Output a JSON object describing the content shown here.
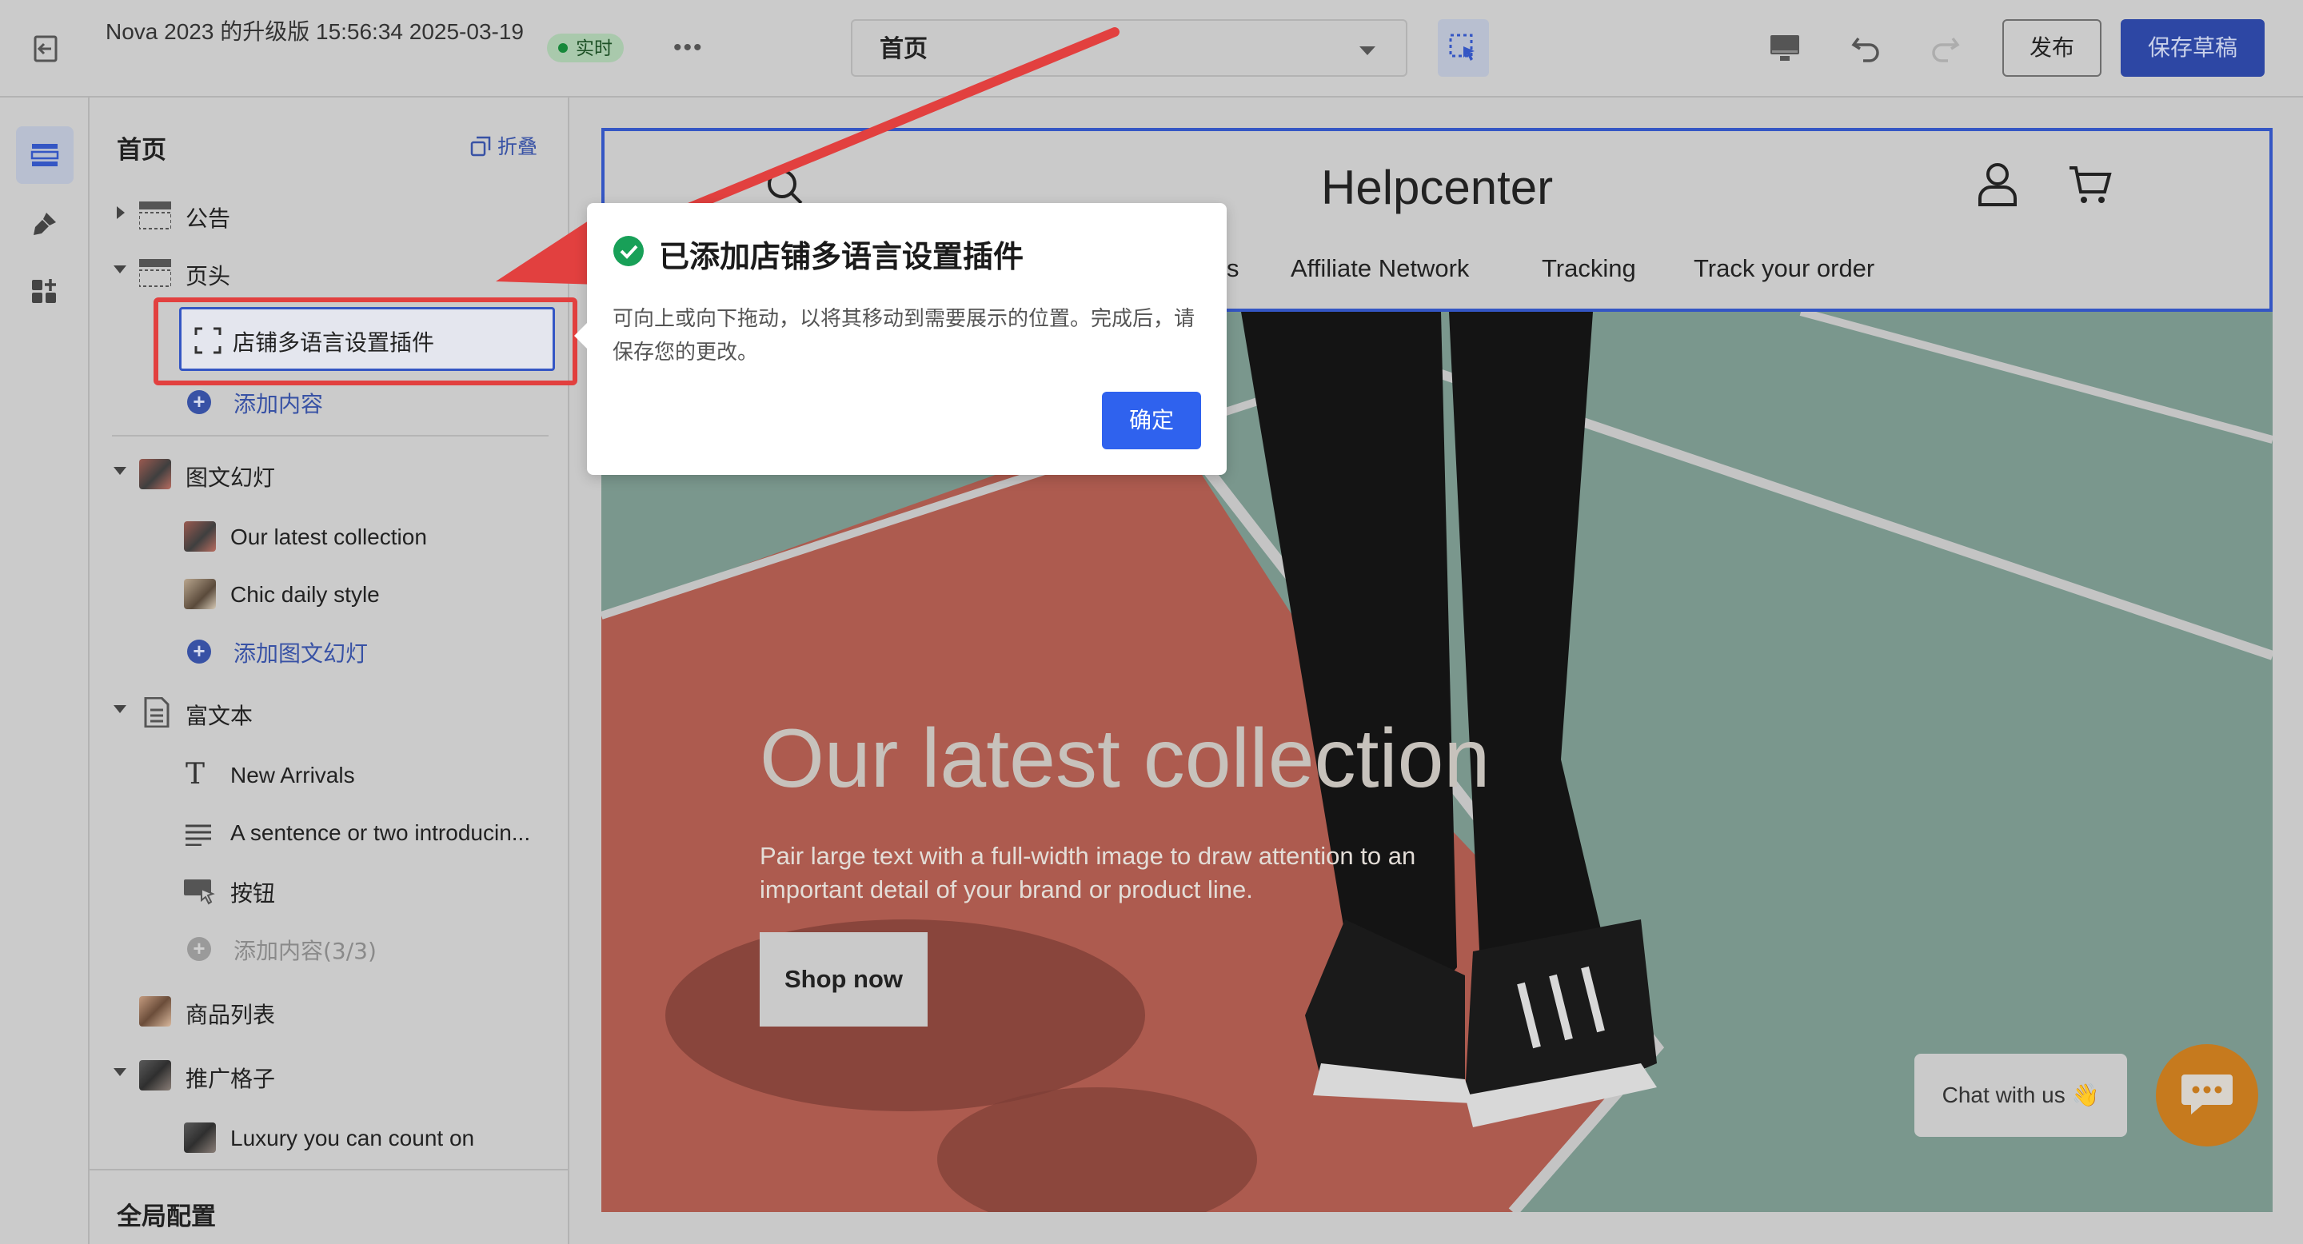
{
  "colors": {
    "accent": "#2f62ee",
    "brand_dark": "#2d47a4",
    "annotation_red": "#e2403f",
    "live_green": "#17883a",
    "chat_orange": "#e8912a"
  },
  "topbar": {
    "title": "Nova 2023 的升级版 15:56:34 2025-03-19",
    "live_badge": "实时",
    "more": "•••",
    "page_select_value": "首页",
    "publish_label": "发布",
    "save_label": "保存草稿",
    "icons": [
      "exit-icon",
      "more-icon",
      "inspect-cursor-icon",
      "desktop-icon",
      "undo-icon",
      "redo-icon"
    ]
  },
  "rail": {
    "items": [
      "sections-icon",
      "theme-brush-icon",
      "apps-icon"
    ]
  },
  "sidebar": {
    "title": "首页",
    "collapse_label": "折叠",
    "items": [
      {
        "label": "公告"
      },
      {
        "label": "页头"
      },
      {
        "label": "店铺多语言设置插件"
      },
      {
        "label": "添加内容"
      },
      {
        "label": "图文幻灯"
      },
      {
        "label": "Our latest collection"
      },
      {
        "label": "Chic daily style"
      },
      {
        "label": "添加图文幻灯"
      },
      {
        "label": "富文本"
      },
      {
        "label": "New Arrivals"
      },
      {
        "label": "A sentence or two introducin..."
      },
      {
        "label": "按钮"
      },
      {
        "label": "添加内容(3/3)"
      },
      {
        "label": "商品列表"
      },
      {
        "label": "推广格子"
      },
      {
        "label": "Luxury you can count on"
      }
    ],
    "global_config": "全局配置"
  },
  "preview": {
    "logo": "Helpcenter",
    "nav": [
      "s",
      "Affiliate Network",
      "Tracking",
      "Track your order"
    ],
    "hero": {
      "title": "Our latest collection",
      "subtitle": "Pair large text with a full-width image to draw attention to an important detail of your brand or product line.",
      "button": "Shop now"
    },
    "chat_label": "Chat with us 👋"
  },
  "popover": {
    "title": "已添加店铺多语言设置插件",
    "body": "可向上或向下拖动，以将其移动到需要展示的位置。完成后，请保存您的更改。",
    "ok": "确定"
  }
}
